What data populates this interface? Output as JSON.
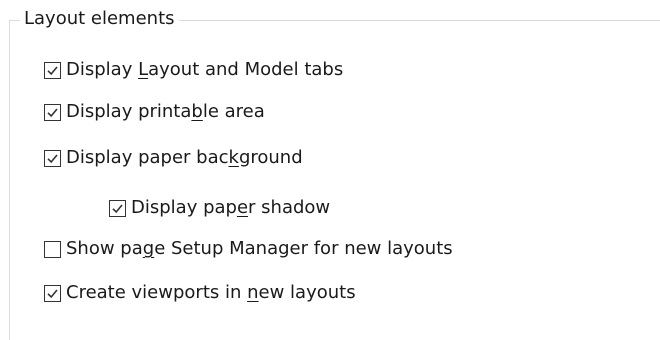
{
  "group": {
    "title": "Layout elements"
  },
  "options": [
    {
      "id": "display-layout-model-tabs",
      "pre": "Display ",
      "mnemonic": "L",
      "post": "ayout and Model tabs",
      "checked": true
    },
    {
      "id": "display-printable-area",
      "pre": "Display printa",
      "mnemonic": "b",
      "post": "le area",
      "checked": true
    },
    {
      "id": "display-paper-background",
      "pre": "Display paper bac",
      "mnemonic": "k",
      "post": "ground",
      "checked": true
    },
    {
      "id": "display-paper-shadow",
      "pre": "Display pap",
      "mnemonic": "e",
      "post": "r shadow",
      "checked": true
    },
    {
      "id": "show-page-setup-manager",
      "pre": "Show pa",
      "mnemonic": "g",
      "post": "e Setup Manager for new layouts",
      "checked": false
    },
    {
      "id": "create-viewports",
      "pre": "Create viewports in ",
      "mnemonic": "n",
      "post": "ew layouts",
      "checked": true
    }
  ],
  "colors": {
    "checkbox_border": "#333333",
    "checkmark": "#333333",
    "group_border": "#dcdcdc",
    "text": "#1a1a1a"
  },
  "icons": {
    "checked": "checkmark-icon"
  }
}
